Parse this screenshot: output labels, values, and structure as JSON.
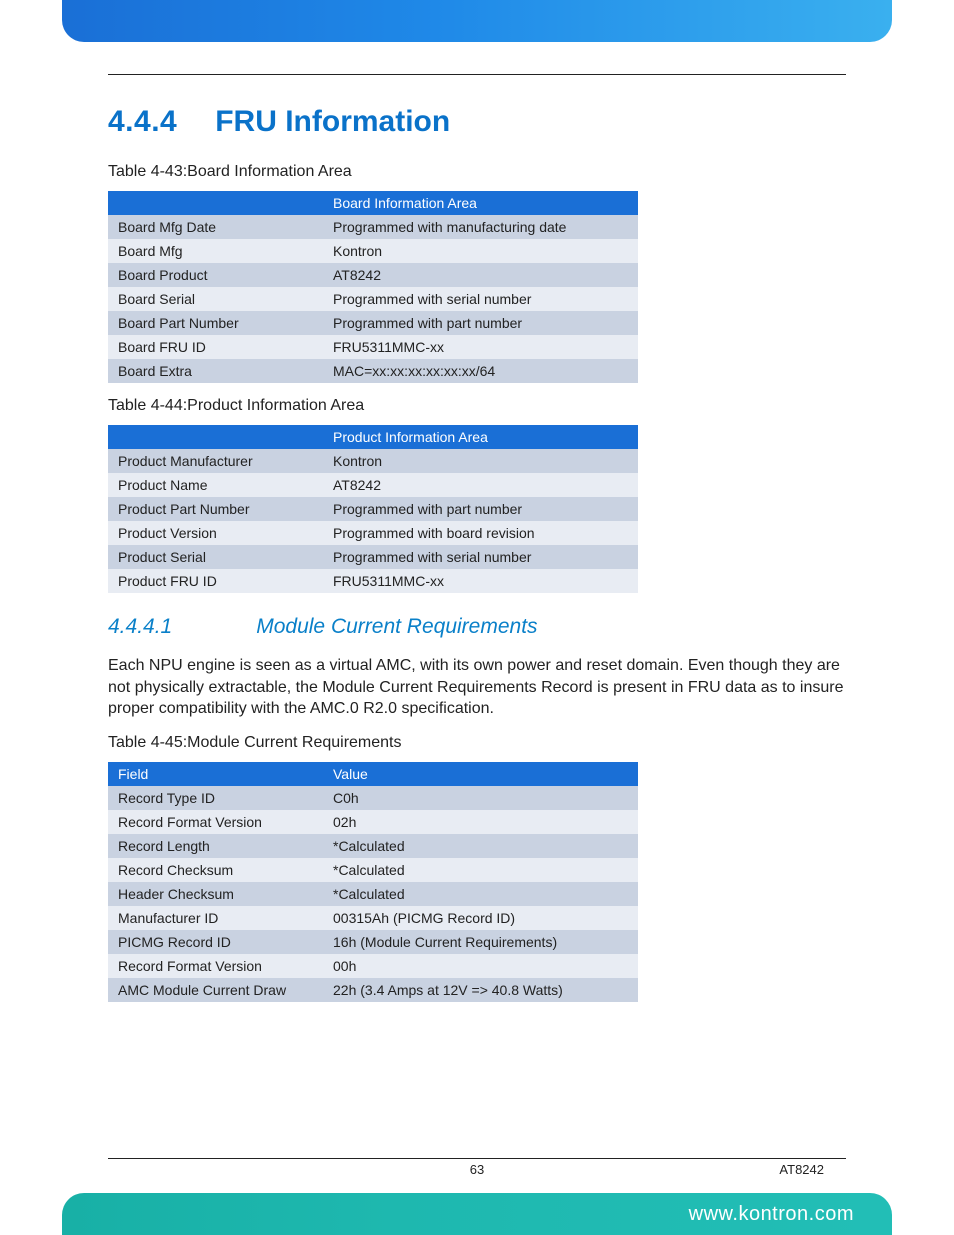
{
  "section": {
    "number": "4.4.4",
    "title": "FRU Information"
  },
  "table43": {
    "caption": "Table 4-43:Board Information Area",
    "header_right": "Board Information Area",
    "rows": [
      {
        "k": "Board Mfg Date",
        "v": "Programmed with manufacturing date"
      },
      {
        "k": "Board Mfg",
        "v": "Kontron"
      },
      {
        "k": "Board Product",
        "v": "AT8242"
      },
      {
        "k": "Board Serial",
        "v": "Programmed with serial number"
      },
      {
        "k": "Board Part Number",
        "v": "Programmed with part number"
      },
      {
        "k": "Board FRU ID",
        "v": "FRU5311MMC-xx"
      },
      {
        "k": "Board Extra",
        "v": "MAC=xx:xx:xx:xx:xx:xx/64"
      }
    ]
  },
  "table44": {
    "caption": "Table 4-44:Product Information Area",
    "header_right": "Product Information Area",
    "rows": [
      {
        "k": "Product Manufacturer",
        "v": "Kontron"
      },
      {
        "k": "Product Name",
        "v": "AT8242"
      },
      {
        "k": "Product Part Number",
        "v": "Programmed with part number"
      },
      {
        "k": "Product Version",
        "v": "Programmed with board revision"
      },
      {
        "k": "Product Serial",
        "v": "Programmed with serial number"
      },
      {
        "k": "Product FRU ID",
        "v": "FRU5311MMC-xx"
      }
    ]
  },
  "subsection": {
    "number": "4.4.4.1",
    "title": "Module Current Requirements"
  },
  "paragraph": "Each NPU engine is seen as a virtual AMC, with its own power and reset domain. Even though they are not physically extractable, the Module Current Requirements Record is present in FRU data as to insure proper compatibility with the AMC.0 R2.0 specification.",
  "table45": {
    "caption": "Table 4-45:Module Current Requirements",
    "headers": [
      "Field",
      "Value"
    ],
    "rows": [
      {
        "k": "Record Type ID",
        "v": "C0h"
      },
      {
        "k": "Record Format Version",
        "v": "02h"
      },
      {
        "k": "Record Length",
        "v": "*Calculated"
      },
      {
        "k": "Record Checksum",
        "v": "*Calculated"
      },
      {
        "k": "Header Checksum",
        "v": "*Calculated"
      },
      {
        "k": "Manufacturer ID",
        "v": "00315Ah (PICMG Record ID)"
      },
      {
        "k": "PICMG Record ID",
        "v": "16h (Module Current Requirements)"
      },
      {
        "k": "Record Format Version",
        "v": "00h"
      },
      {
        "k": "AMC Module Current Draw",
        "v": "22h (3.4 Amps at 12V => 40.8 Watts)"
      }
    ]
  },
  "footer": {
    "page": "63",
    "doc": "AT8242",
    "url": "www.kontron.com"
  }
}
